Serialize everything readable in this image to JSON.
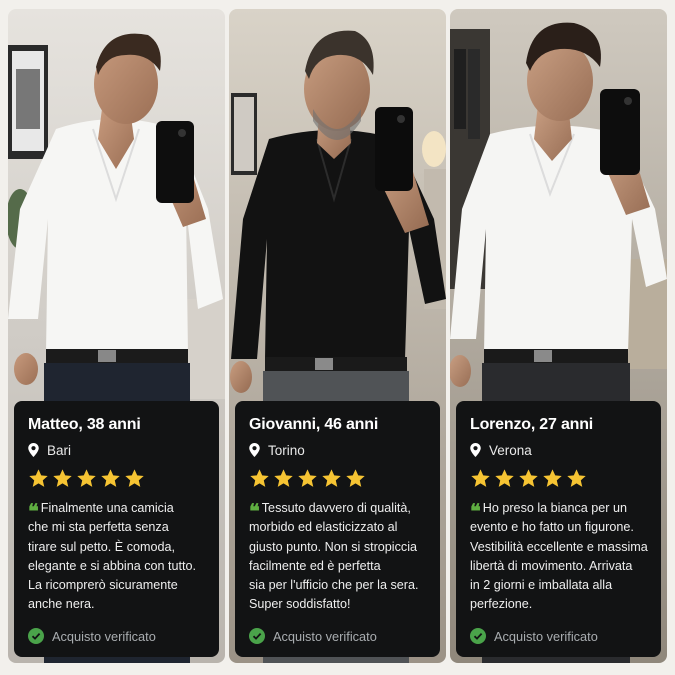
{
  "colors": {
    "card_bg": "#121314",
    "star": "#f6c433",
    "quote_green": "#5fae41",
    "verified_green": "#4aa34a"
  },
  "testimonials": [
    {
      "name": "Matteo, 38 anni",
      "city": "Bari",
      "rating_out_of_5": 5,
      "shirt_color": "white",
      "review_lines": [
        "Finalmente una camicia",
        "che mi sta perfetta senza",
        "tirare sul petto. È comoda,",
        "elegante e si abbina con tutto.",
        "La ricomprerò sicuramente",
        "anche nera."
      ],
      "verified_label": "Acquisto verificato"
    },
    {
      "name": "Giovanni, 46 anni",
      "city": "Torino",
      "rating_out_of_5": 5,
      "shirt_color": "black",
      "review_lines": [
        "Tessuto davvero di qualità,",
        "morbido ed elasticizzato al",
        "giusto punto. Non si stropiccia",
        "facilmente ed è perfetta",
        "sia per l'ufficio che per la sera.",
        "Super soddisfatto!"
      ],
      "verified_label": "Acquisto verificato"
    },
    {
      "name": "Lorenzo, 27 anni",
      "city": "Verona",
      "rating_out_of_5": 5,
      "shirt_color": "white",
      "review_lines": [
        "Ho preso la bianca per un",
        "evento e ho fatto un figurone.",
        "Vestibilità eccellente e massima",
        "libertà di movimento. Arrivata",
        "in 2 giorni e imballata alla",
        "perfezione."
      ],
      "verified_label": "Acquisto verificato"
    }
  ]
}
